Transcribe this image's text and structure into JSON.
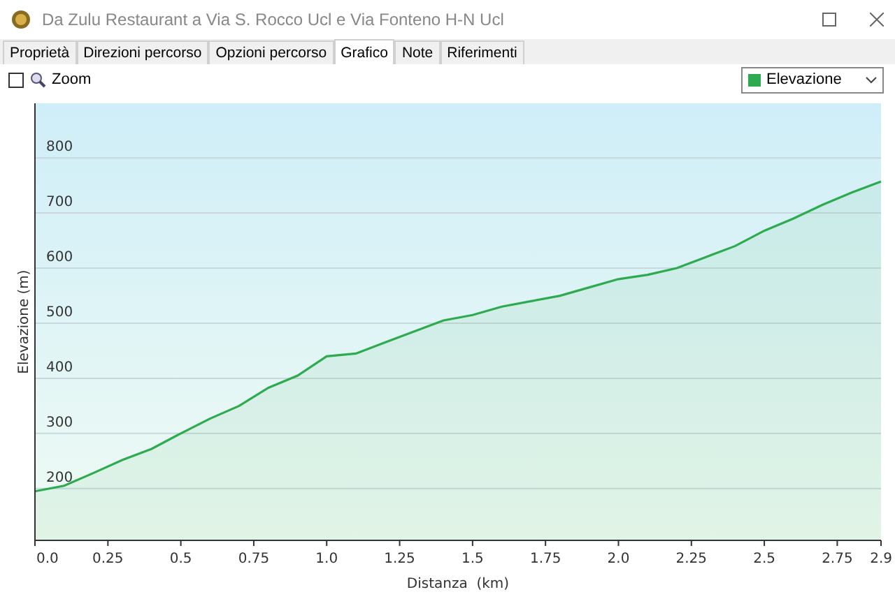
{
  "window": {
    "title": "Da Zulu Restaurant a Via S. Rocco Ucl e Via Fonteno H-N Ucl"
  },
  "tabs": [
    {
      "label": "Proprietà",
      "selected": false
    },
    {
      "label": "Direzioni percorso",
      "selected": false
    },
    {
      "label": "Opzioni percorso",
      "selected": false
    },
    {
      "label": "Grafico",
      "selected": true
    },
    {
      "label": "Note",
      "selected": false
    },
    {
      "label": "Riferimenti",
      "selected": false
    }
  ],
  "toolbar": {
    "zoom": {
      "label": "Zoom",
      "checked": false
    }
  },
  "chart": {
    "chart_data": {
      "type": "area",
      "xlabel": "Distanza  (km)",
      "ylabel": "Elevazione (m)",
      "x": [
        0,
        0.1,
        0.2,
        0.3,
        0.4,
        0.5,
        0.6,
        0.7,
        0.8,
        0.9,
        1.0,
        1.1,
        1.2,
        1.3,
        1.4,
        1.5,
        1.6,
        1.7,
        1.8,
        1.9,
        2.0,
        2.1,
        2.2,
        2.3,
        2.4,
        2.5,
        2.6,
        2.7,
        2.8,
        2.9
      ],
      "series": [
        {
          "name": "Elevazione",
          "color": "#2eaa4f",
          "values": [
            195,
            205,
            228,
            252,
            272,
            300,
            327,
            350,
            383,
            405,
            440,
            445,
            465,
            485,
            505,
            515,
            530,
            540,
            550,
            565,
            580,
            588,
            600,
            620,
            640,
            668,
            690,
            715,
            737,
            757
          ]
        }
      ],
      "xlim": [
        0,
        2.9
      ],
      "ylim": [
        106,
        899
      ],
      "xticks": [
        {
          "value": 0,
          "label": "0.0"
        },
        {
          "value": 0.25,
          "label": "0.25"
        },
        {
          "value": 0.5,
          "label": "0.5"
        },
        {
          "value": 0.75,
          "label": "0.75"
        },
        {
          "value": 1,
          "label": "1.0"
        },
        {
          "value": 1.25,
          "label": "1.25"
        },
        {
          "value": 1.5,
          "label": "1.5"
        },
        {
          "value": 1.75,
          "label": "1.75"
        },
        {
          "value": 2,
          "label": "2.0"
        },
        {
          "value": 2.25,
          "label": "2.25"
        },
        {
          "value": 2.5,
          "label": "2.5"
        },
        {
          "value": 2.75,
          "label": "2.75"
        },
        {
          "value": 2.9,
          "label": "2.9"
        }
      ],
      "yticks": [
        200,
        300,
        400,
        500,
        600,
        700,
        800
      ],
      "grid": true
    }
  }
}
